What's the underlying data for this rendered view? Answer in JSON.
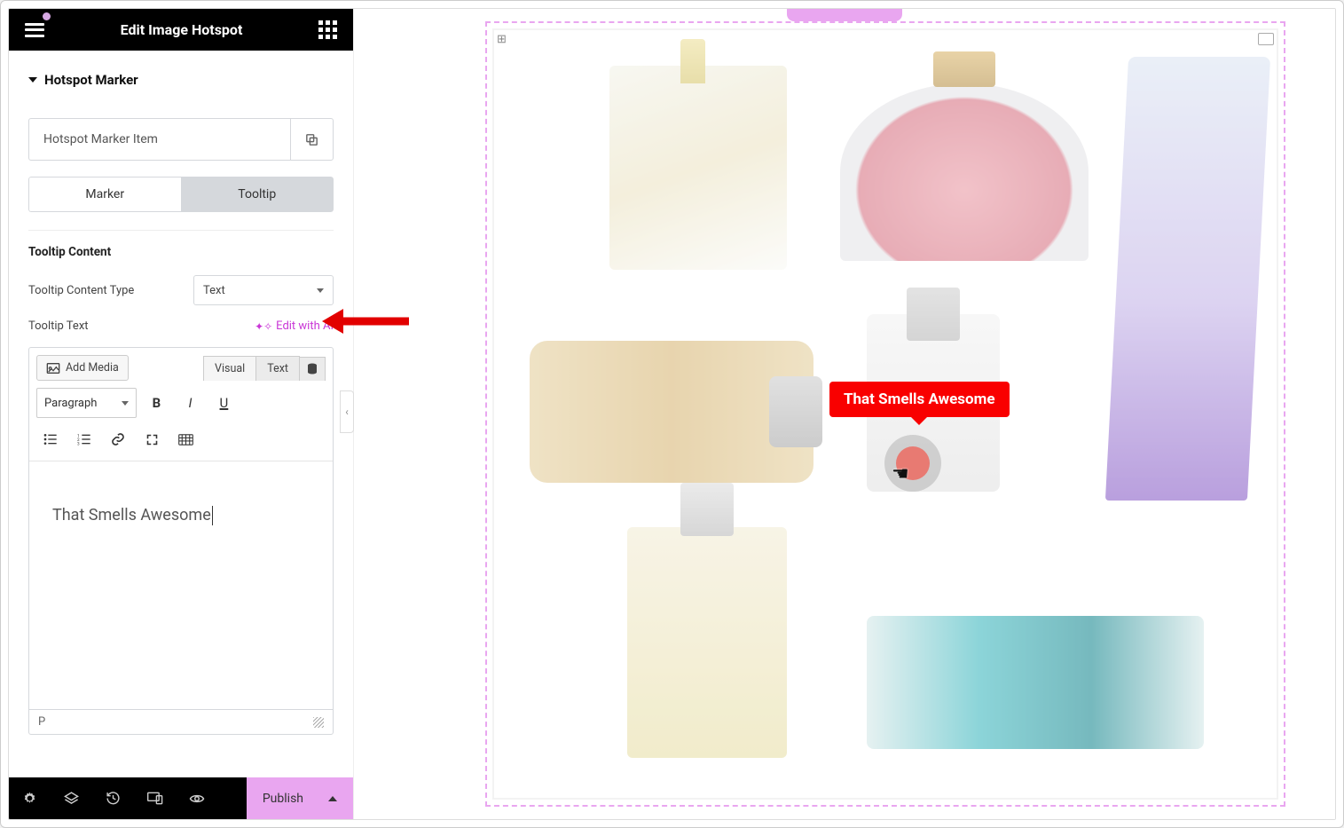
{
  "header": {
    "title": "Edit Image Hotspot"
  },
  "accordion": {
    "title": "Hotspot Marker"
  },
  "item": {
    "label": "Hotspot Marker Item"
  },
  "tabs": {
    "marker": "Marker",
    "tooltip": "Tooltip"
  },
  "section": {
    "title": "Tooltip Content",
    "content_type_label": "Tooltip Content Type",
    "content_type_value": "Text",
    "text_label": "Tooltip Text",
    "ai_link": "Edit with AI"
  },
  "editor": {
    "add_media": "Add Media",
    "mode_visual": "Visual",
    "mode_text": "Text",
    "format": "Paragraph",
    "content": "That Smells Awesome",
    "status": "P"
  },
  "footer": {
    "publish": "Publish"
  },
  "preview": {
    "tooltip_text": "That Smells Awesome"
  }
}
